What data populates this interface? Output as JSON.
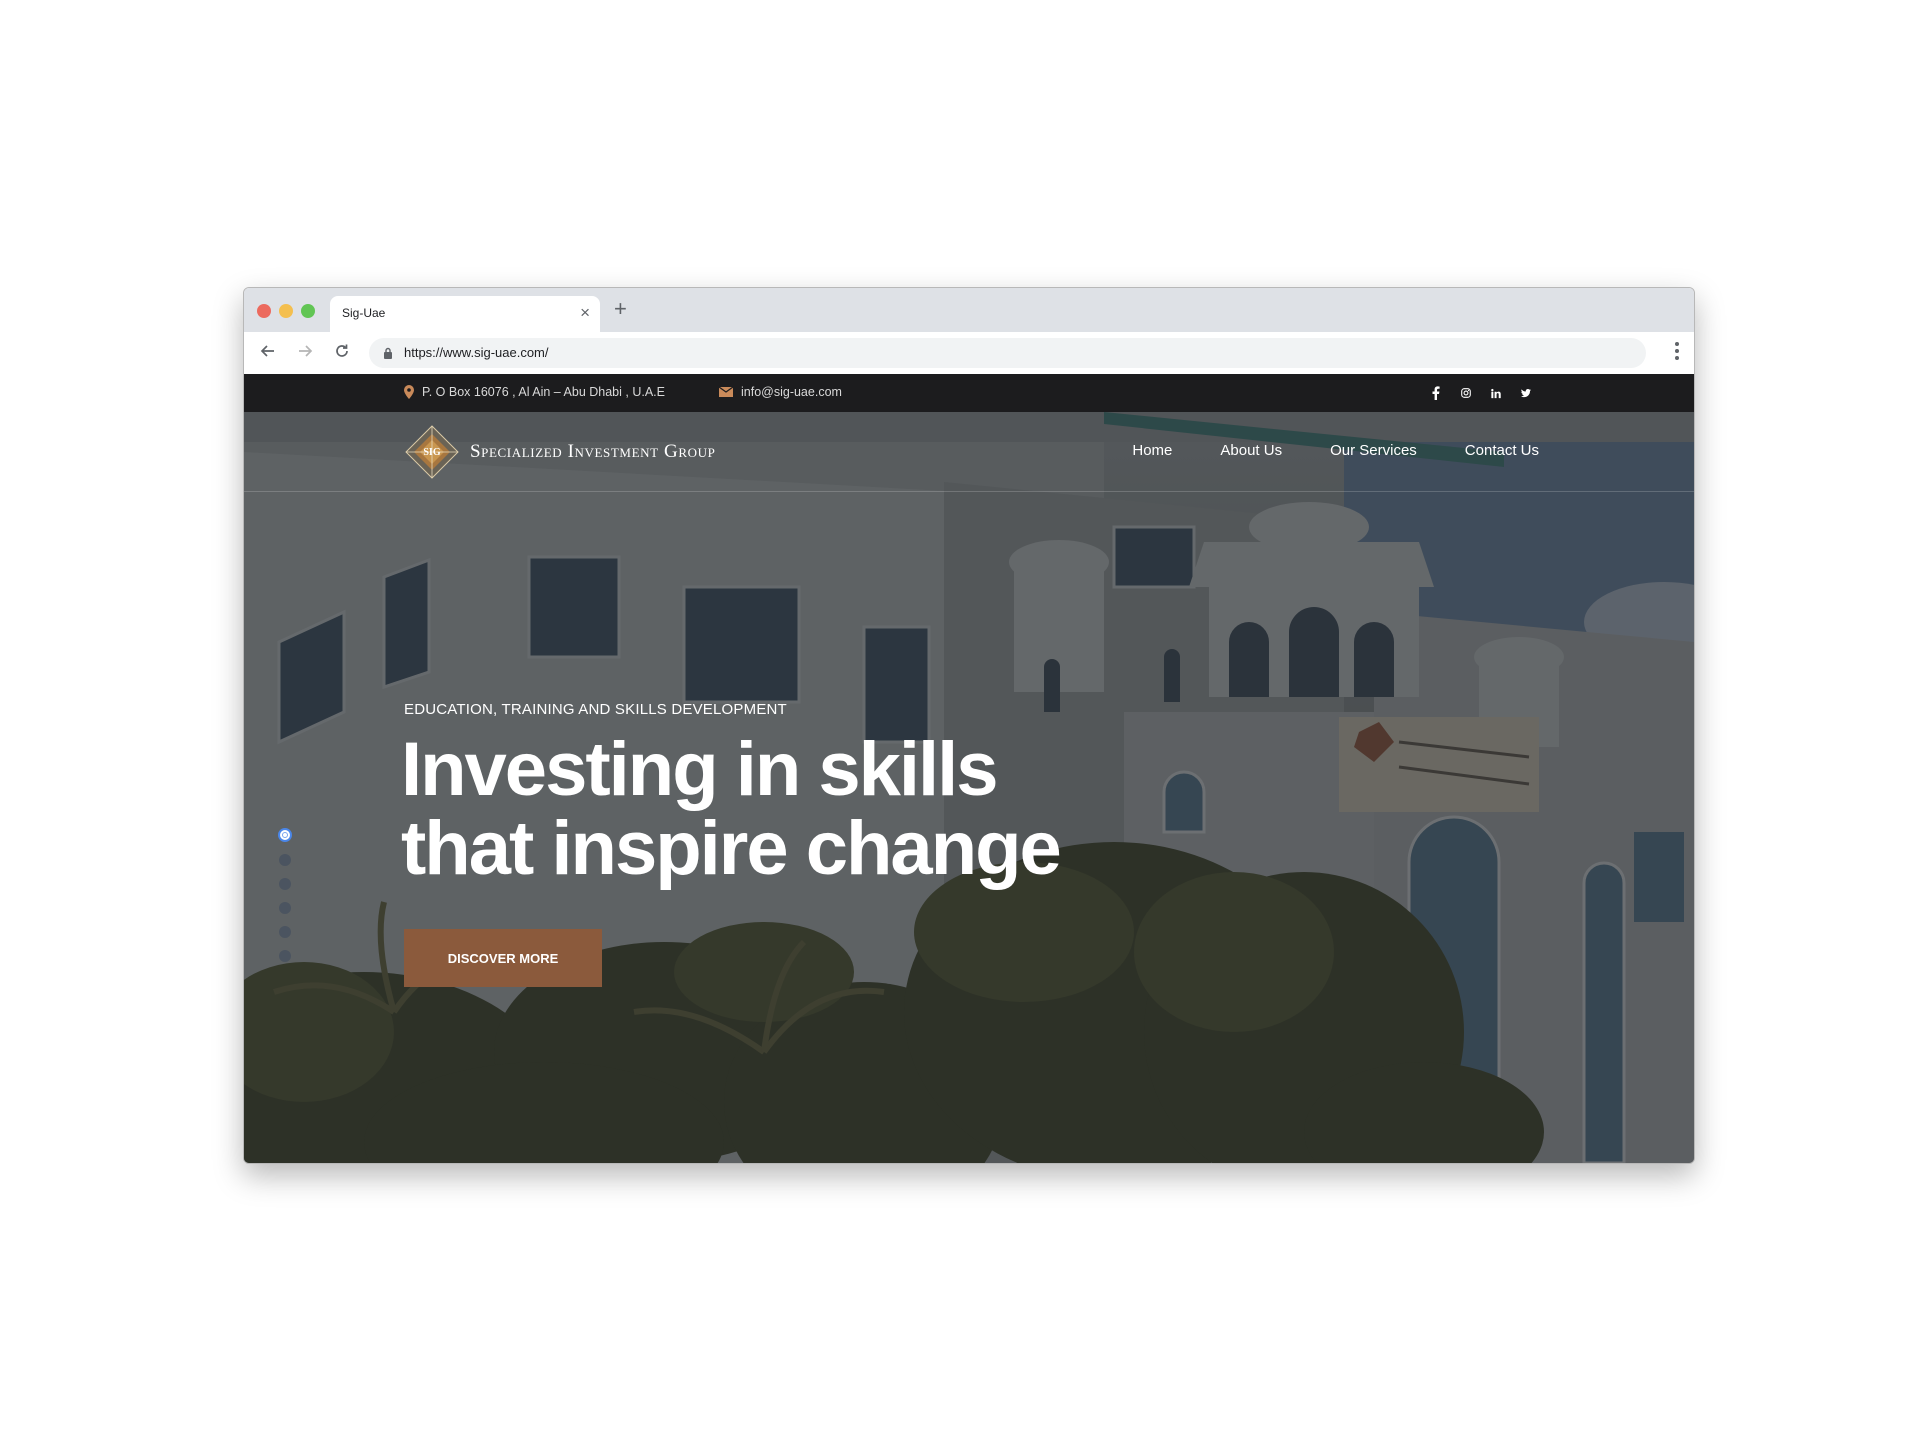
{
  "browser": {
    "tab_title": "Sig-Uae",
    "url": "https://www.sig-uae.com/"
  },
  "topbar": {
    "address": "P. O Box 16076 , Al Ain – Abu Dhabi , U.A.E",
    "email": "info@sig-uae.com",
    "socials": [
      "facebook-icon",
      "instagram-icon",
      "linkedin-icon",
      "twitter-icon"
    ]
  },
  "header": {
    "logo_mark": "SIG",
    "logo_text": "Specialized Investment Group",
    "nav": {
      "home": "Home",
      "about": "About Us",
      "services": "Our Services",
      "contact": "Contact Us"
    }
  },
  "hero": {
    "eyebrow": "EDUCATION, TRAINING AND SKILLS DEVELOPMENT",
    "headline_line1": "Investing in skills",
    "headline_line2": "that inspire change",
    "cta_label": "DISCOVER MORE",
    "slide_count": 6,
    "active_slide": 1
  },
  "colors": {
    "accent": "#8b5a3c",
    "topbar_bg": "#1c1c1e",
    "icon_accent": "#c98a5a"
  }
}
